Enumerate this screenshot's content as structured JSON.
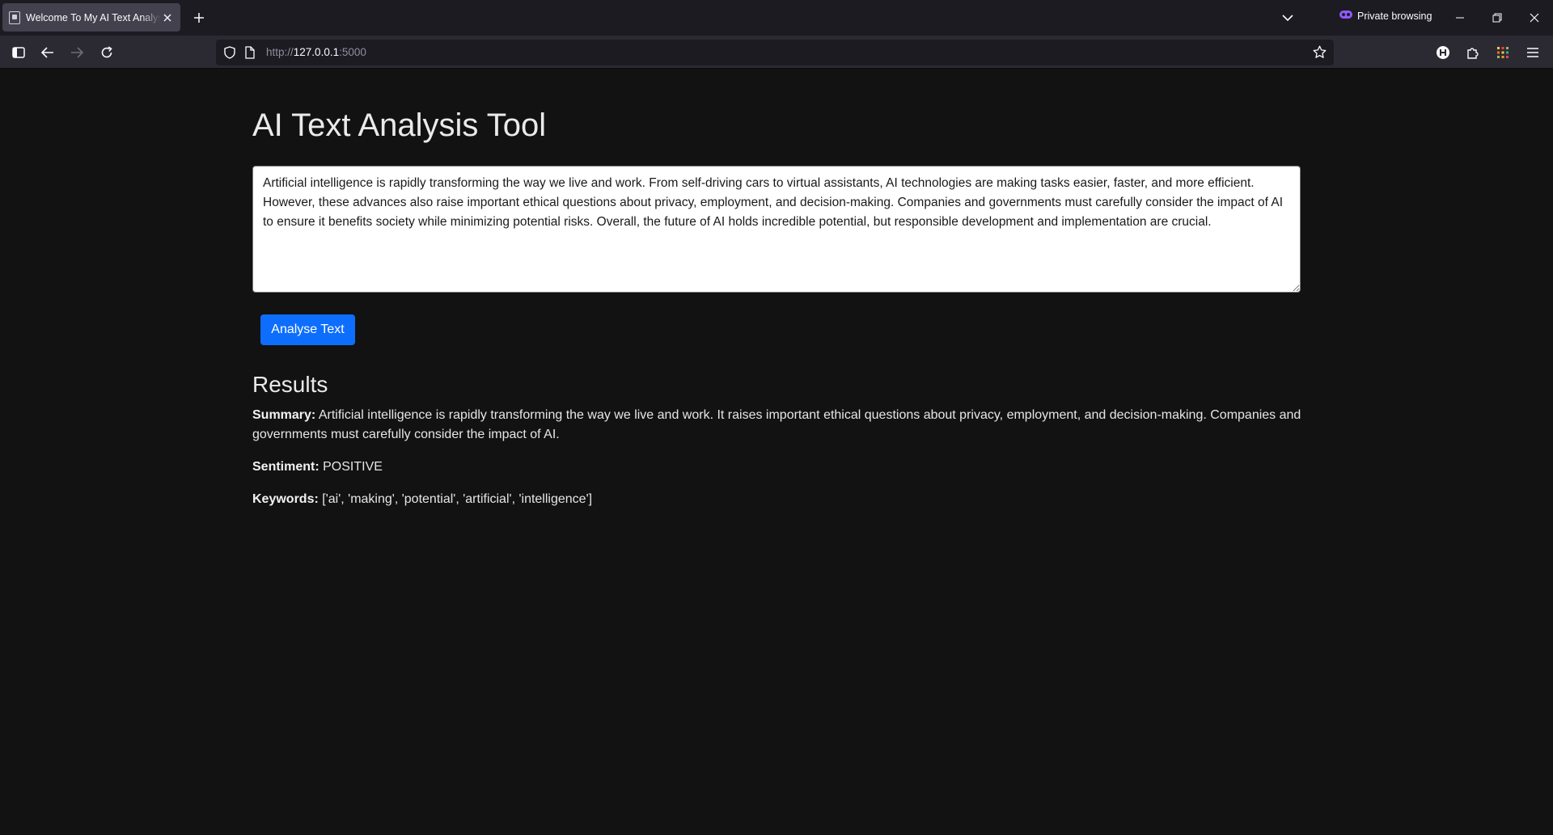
{
  "browser": {
    "tab": {
      "title": "Welcome To My AI Text Analysis"
    },
    "private_label": "Private browsing",
    "url": {
      "scheme": "http://",
      "host": "127.0.0.1",
      "port": ":5000"
    },
    "icons": {
      "favicon": "page-icon",
      "tab_close": "close-icon",
      "new_tab": "plus-icon",
      "tab_list": "chevron-down-icon",
      "private": "private-mask-icon",
      "minimize": "minimize-icon",
      "restore": "restore-icon",
      "close_window": "close-icon",
      "sidebar": "sidebar-icon",
      "back": "arrow-left-icon",
      "forward": "arrow-right-icon",
      "reload": "reload-icon",
      "tracking": "shield-icon",
      "page_info": "page-icon",
      "bookmark": "star-icon",
      "account": "account-icon",
      "extensions": "puzzle-icon",
      "extension_app": "grid-icon",
      "menu": "hamburger-icon"
    }
  },
  "page": {
    "title": "AI Text Analysis Tool",
    "input_text": "Artificial intelligence is rapidly transforming the way we live and work. From self-driving cars to virtual assistants, AI technologies are making tasks easier, faster, and more efficient. However, these advances also raise important ethical questions about privacy, employment, and decision-making. Companies and governments must carefully consider the impact of AI to ensure it benefits society while minimizing potential risks. Overall, the future of AI holds incredible potential, but responsible development and implementation are crucial.",
    "analyse_button": "Analyse Text",
    "results": {
      "heading": "Results",
      "summary_label": "Summary:",
      "summary_value": "Artificial intelligence is rapidly transforming the way we live and work. It raises important ethical questions about privacy, employment, and decision-making. Companies and governments must carefully consider the impact of AI.",
      "sentiment_label": "Sentiment:",
      "sentiment_value": "POSITIVE",
      "keywords_label": "Keywords:",
      "keywords_value": "['ai', 'making', 'potential', 'artificial', 'intelligence']"
    }
  },
  "colors": {
    "page_background": "#121212",
    "button_primary": "#0d6efd",
    "tabbar_background": "#1c1b22",
    "toolbar_background": "#2b2a33",
    "private_accent": "#9059ff"
  }
}
